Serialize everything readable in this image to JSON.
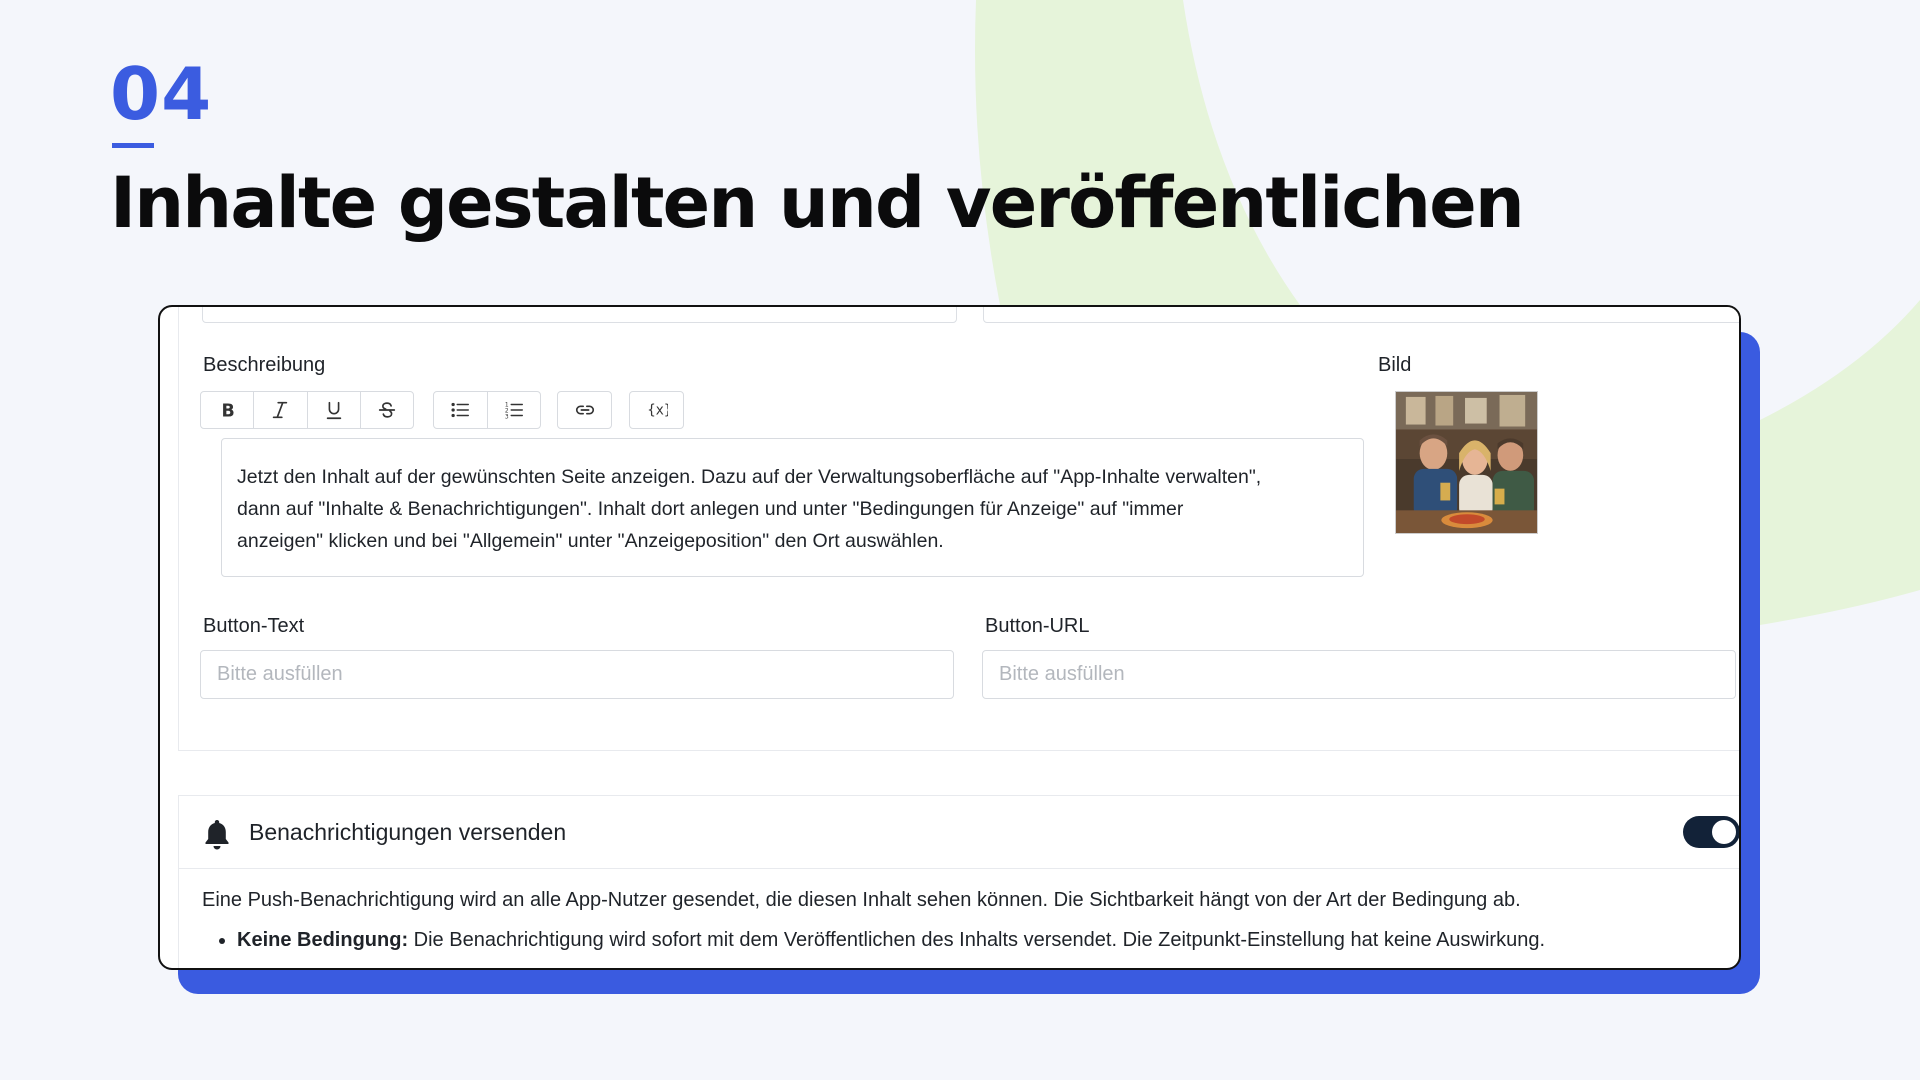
{
  "step": {
    "number": "04"
  },
  "page": {
    "title": "Inhalte gestalten und veröffentlichen"
  },
  "colors": {
    "accent": "#3b5ce0",
    "shadow": "#3a5be0",
    "decoration": "#e6f4da",
    "toggle_on": "#122238",
    "title": "#0b0b0c"
  },
  "form": {
    "description": {
      "label": "Beschreibung",
      "toolbar": {
        "bold": "bold-icon",
        "italic": "italic-icon",
        "underline": "underline-icon",
        "strikethrough": "strikethrough-icon",
        "bullet_list": "bullet-list-icon",
        "numbered_list": "numbered-list-icon",
        "link": "link-icon",
        "variable": "variable-icon"
      },
      "lines": [
        "Jetzt den Inhalt auf der gewünschten Seite anzeigen. Dazu auf der Verwaltungsoberfläche auf \"App-Inhalte verwalten\",",
        "dann auf \"Inhalte & Benachrichtigungen\". Inhalt dort anlegen und unter \"Bedingungen für Anzeige\" auf \"immer",
        "anzeigen\" klicken und bei \"Allgemein\" unter \"Anzeigeposition\" den Ort auswählen."
      ]
    },
    "image": {
      "label": "Bild"
    },
    "button_text": {
      "label": "Button-Text",
      "placeholder": "Bitte ausfüllen"
    },
    "button_url": {
      "label": "Button-URL",
      "placeholder": "Bitte ausfüllen"
    }
  },
  "notifications": {
    "title": "Benachrichtigungen versenden",
    "icon": "bell-icon",
    "enabled": true,
    "description": "Eine Push-Benachrichtigung wird an alle App-Nutzer gesendet, die diesen Inhalt sehen können. Die Sichtbarkeit hängt von der Art der Bedingung ab.",
    "items": [
      {
        "term": "Keine Bedingung:",
        "text": " Die Benachrichtigung wird sofort mit dem Veröffentlichen des Inhalts versendet. Die Zeitpunkt-Einstellung hat keine Auswirkung."
      }
    ]
  }
}
